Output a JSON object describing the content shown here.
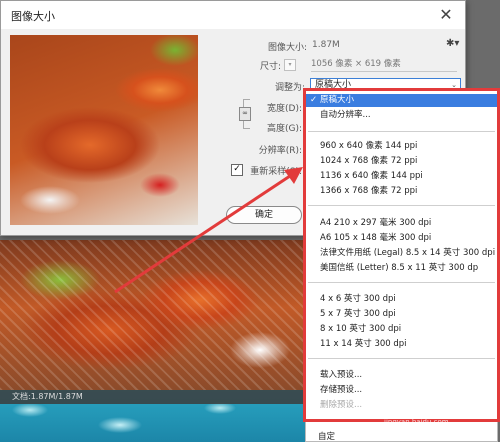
{
  "dialog": {
    "title": "图像大小",
    "close_icon": "close-icon",
    "image_size_label": "图像大小:",
    "image_size_value": "1.87M",
    "settings_icon": "gear-icon",
    "dimensions_label": "尺寸:",
    "dimensions_value": "1056 像素 × 619 像素",
    "fit_to_label": "调整为:",
    "fit_to_value": "原稿大小",
    "width_label": "宽度(D):",
    "height_label": "高度(G):",
    "resolution_label": "分辨率(R):",
    "resample_label": "重新采样(S):",
    "resample_checked": true,
    "ok_label": "确定"
  },
  "menu": {
    "items": [
      {
        "label": "原稿大小",
        "selected": true
      },
      {
        "label": "自动分辨率..."
      },
      {
        "label": "960 x 640 像素 144 ppi"
      },
      {
        "label": "1024 x 768 像素 72 ppi"
      },
      {
        "label": "1136 x 640 像素 144 ppi"
      },
      {
        "label": "1366 x 768 像素 72 ppi"
      },
      {
        "label": "A4 210 x 297 毫米 300 dpi"
      },
      {
        "label": "A6 105 x 148 毫米 300 dpi"
      },
      {
        "label": "法律文件用纸 (Legal) 8.5 x 14 英寸 300 dpi"
      },
      {
        "label": "美国信纸 (Letter) 8.5 x 11 英寸 300 dp"
      },
      {
        "label": "4 x 6 英寸 300 dpi"
      },
      {
        "label": "5 x 7 英寸 300 dpi"
      },
      {
        "label": "8 x 10 英寸 300 dpi"
      },
      {
        "label": "11 x 14 英寸 300 dpi"
      },
      {
        "label": "载入预设..."
      },
      {
        "label": "存储预设..."
      },
      {
        "label": "删除预设...",
        "disabled": true
      }
    ],
    "custom_label": "自定"
  },
  "workspace": {
    "status_text": "文档:1.87M/1.87M"
  },
  "watermark": {
    "text": "Bai 经验",
    "sub": "jingyan.baidu.com"
  },
  "colors": {
    "accent": "#3a7de0",
    "annotation": "#e23b3b"
  }
}
